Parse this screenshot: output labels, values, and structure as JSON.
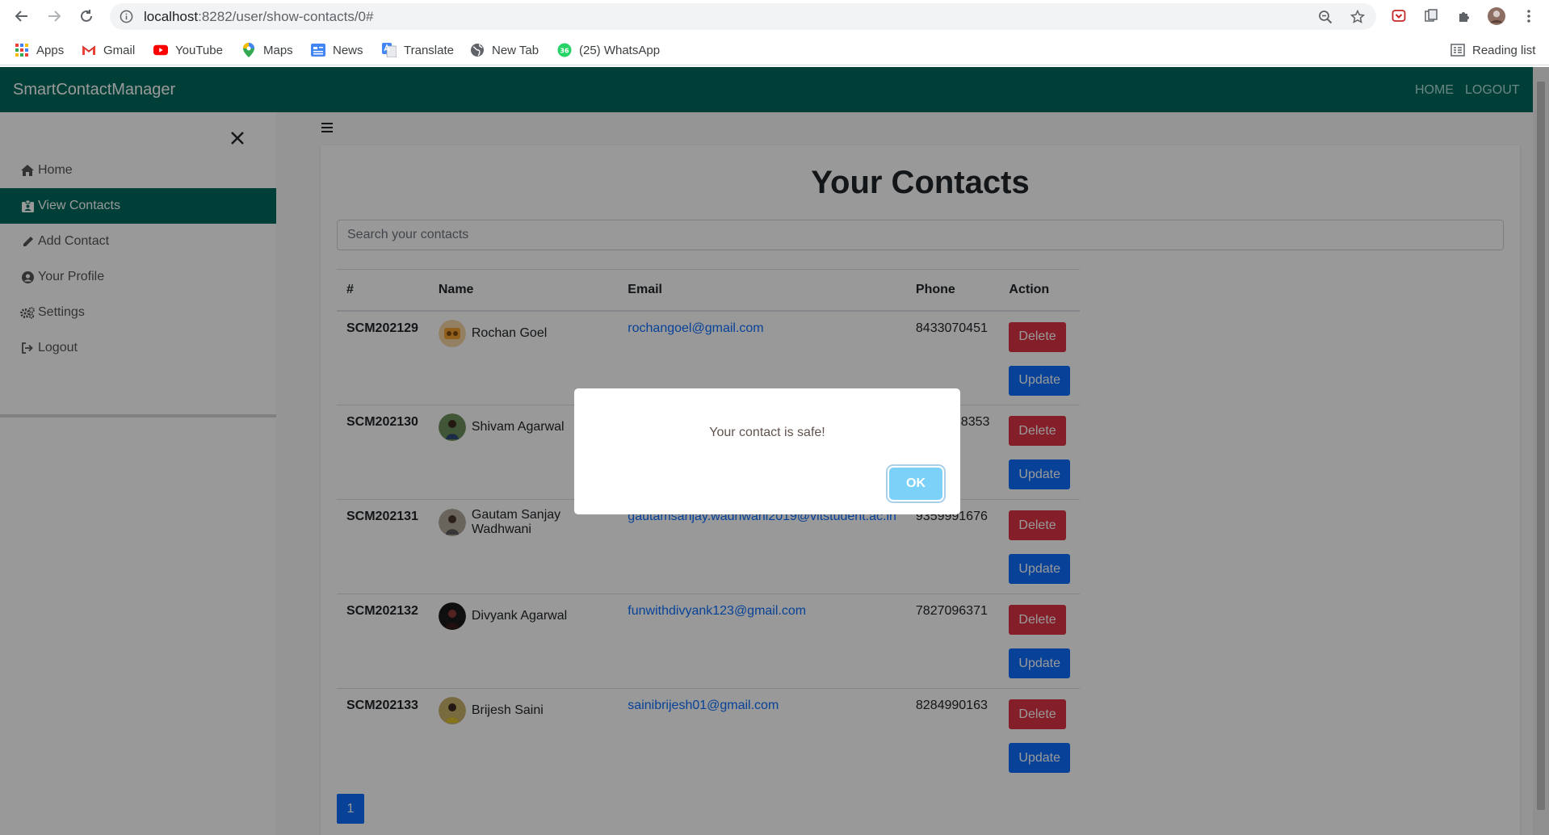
{
  "browser": {
    "url_host": "localhost",
    "url_path": ":8282/user/show-contacts/0#",
    "bookmarks": [
      {
        "label": "Apps",
        "icon": "apps-grid-icon"
      },
      {
        "label": "Gmail",
        "icon": "gmail-icon"
      },
      {
        "label": "YouTube",
        "icon": "youtube-icon"
      },
      {
        "label": "Maps",
        "icon": "maps-pin-icon"
      },
      {
        "label": "News",
        "icon": "news-icon"
      },
      {
        "label": "Translate",
        "icon": "translate-icon"
      },
      {
        "label": "New Tab",
        "icon": "globe-icon"
      },
      {
        "label": "(25) WhatsApp",
        "icon": "whatsapp-icon"
      }
    ],
    "reading_list": "Reading list"
  },
  "navbar": {
    "brand": "SmartContactManager",
    "home": "HOME",
    "logout": "LOGOUT"
  },
  "sidebar": {
    "items": [
      {
        "label": "Home",
        "icon": "home-icon"
      },
      {
        "label": "View Contacts",
        "icon": "id-card-icon"
      },
      {
        "label": "Add Contact",
        "icon": "pencil-icon"
      },
      {
        "label": "Your Profile",
        "icon": "user-circle-icon"
      },
      {
        "label": "Settings",
        "icon": "cogs-icon"
      },
      {
        "label": "Logout",
        "icon": "sign-out-icon"
      }
    ],
    "active_index": 1
  },
  "main": {
    "title": "Your Contacts",
    "search_placeholder": "Search your contacts",
    "table": {
      "headers": [
        "#",
        "Name",
        "Email",
        "Phone",
        "Action"
      ],
      "rows": [
        {
          "id": "SCM202129",
          "name": "Rochan Goel",
          "email": "rochangoel@gmail.com",
          "phone": "8433070451"
        },
        {
          "id": "SCM202130",
          "name": "Shivam Agarwal",
          "email": "",
          "phone": "98353"
        },
        {
          "id": "SCM202131",
          "name": "Gautam Sanjay Wadhwani",
          "email": "gautamsanjay.wadhwani2019@vitstudent.ac.in",
          "phone": "9359991676"
        },
        {
          "id": "SCM202132",
          "name": "Divyank Agarwal",
          "email": "funwithdivyank123@gmail.com",
          "phone": "7827096371"
        },
        {
          "id": "SCM202133",
          "name": "Brijesh Saini",
          "email": "sainibrijesh01@gmail.com",
          "phone": "8284990163"
        }
      ],
      "delete_label": "Delete",
      "update_label": "Update"
    },
    "pagination": {
      "current": "1"
    }
  },
  "modal": {
    "message": "Your contact is safe!",
    "ok_label": "OK"
  },
  "colors": {
    "navbar": "#00695c",
    "danger": "#dc3545",
    "primary": "#0d6efd",
    "ok_button": "#7cd1f9"
  }
}
